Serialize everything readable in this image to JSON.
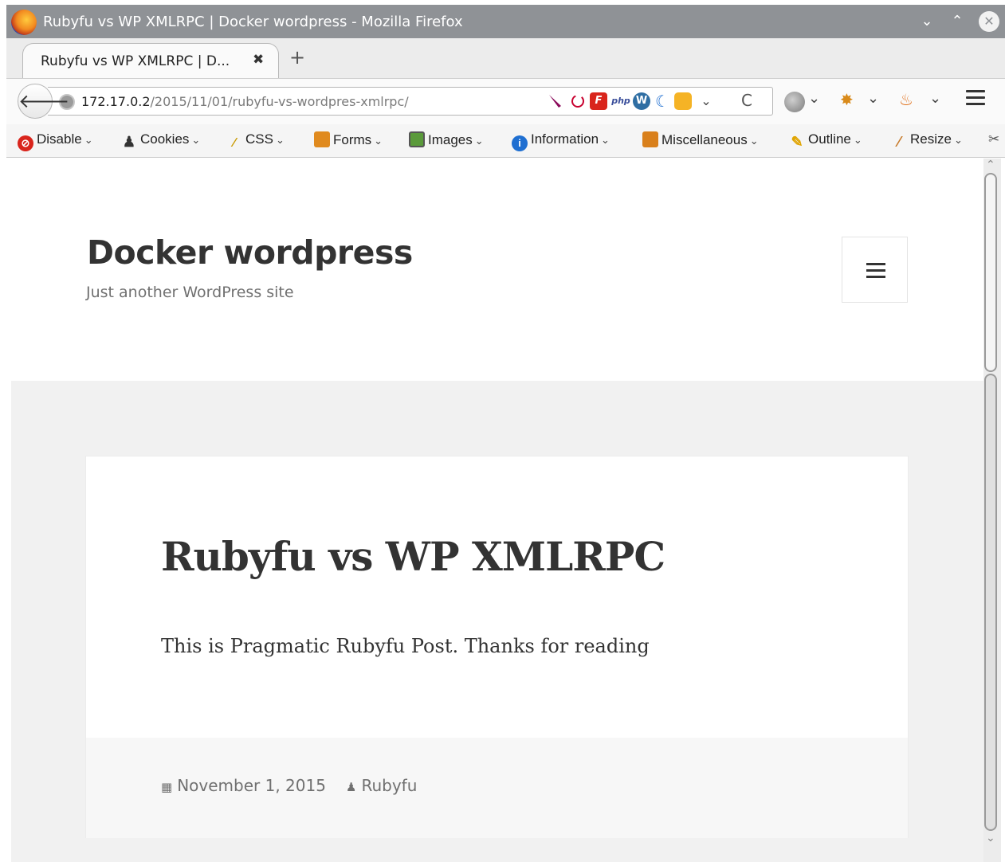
{
  "window": {
    "title": "Rubyfu vs WP XMLRPC | Docker wordpress - Mozilla Firefox",
    "minimize_glyph": "⌄",
    "maximize_glyph": "⌃",
    "close_glyph": "✕"
  },
  "tabs": [
    {
      "label": "Rubyfu vs WP XMLRPC | D...",
      "close_glyph": "✖"
    }
  ],
  "new_tab_glyph": "+",
  "nav": {
    "back_glyph": "🡐",
    "url_host": "172.17.0.2",
    "url_path": "/2015/11/01/rubyfu-vs-wordpres-xmlrpc/",
    "reload_glyph": "C",
    "dropdown_glyph": "⌄",
    "icons": [
      "feather-icon",
      "debian-swirl-icon",
      "firebug-f-icon",
      "php-icon",
      "wordpress-icon",
      "moon-icon",
      "cube-icon",
      "globe-menu-icon",
      "bug-icon",
      "gecko-icon",
      "menu-icon"
    ],
    "ext_labels": {
      "firebug": "F",
      "php": "php",
      "wordpress": "W",
      "moon": "☾"
    }
  },
  "webdev_toolbar": {
    "items": [
      {
        "label": "Disable",
        "icon": "disable-icon",
        "color": "#d9251c"
      },
      {
        "label": "Cookies",
        "icon": "cookies-icon",
        "color": "#333333"
      },
      {
        "label": "CSS",
        "icon": "css-wand-icon",
        "color": "#e0a400"
      },
      {
        "label": "Forms",
        "icon": "forms-clipboard-icon",
        "color": "#e08a1e"
      },
      {
        "label": "Images",
        "icon": "images-icon",
        "color": "#5a9a3a"
      },
      {
        "label": "Information",
        "icon": "information-icon",
        "color": "#1f6fd1"
      },
      {
        "label": "Miscellaneous",
        "icon": "miscellaneous-icon",
        "color": "#d9801c"
      },
      {
        "label": "Outline",
        "icon": "outline-pencil-icon",
        "color": "#e0a400"
      },
      {
        "label": "Resize",
        "icon": "resize-icon",
        "color": "#c77a2a"
      }
    ],
    "chevron_glyph": "⌄",
    "tools_glyph": "✂"
  },
  "site": {
    "title": "Docker wordpress",
    "description": "Just another WordPress site"
  },
  "post": {
    "title": "Rubyfu vs WP XMLRPC",
    "body": "This is Pragmatic Rubyfu Post. Thanks for reading",
    "date": "November 1, 2015",
    "author": "Rubyfu",
    "date_icon_glyph": "▦",
    "author_icon_glyph": "♟"
  },
  "scrollbar": {
    "up_glyph": "⌃",
    "down_glyph": "⌄",
    "position": 0
  }
}
